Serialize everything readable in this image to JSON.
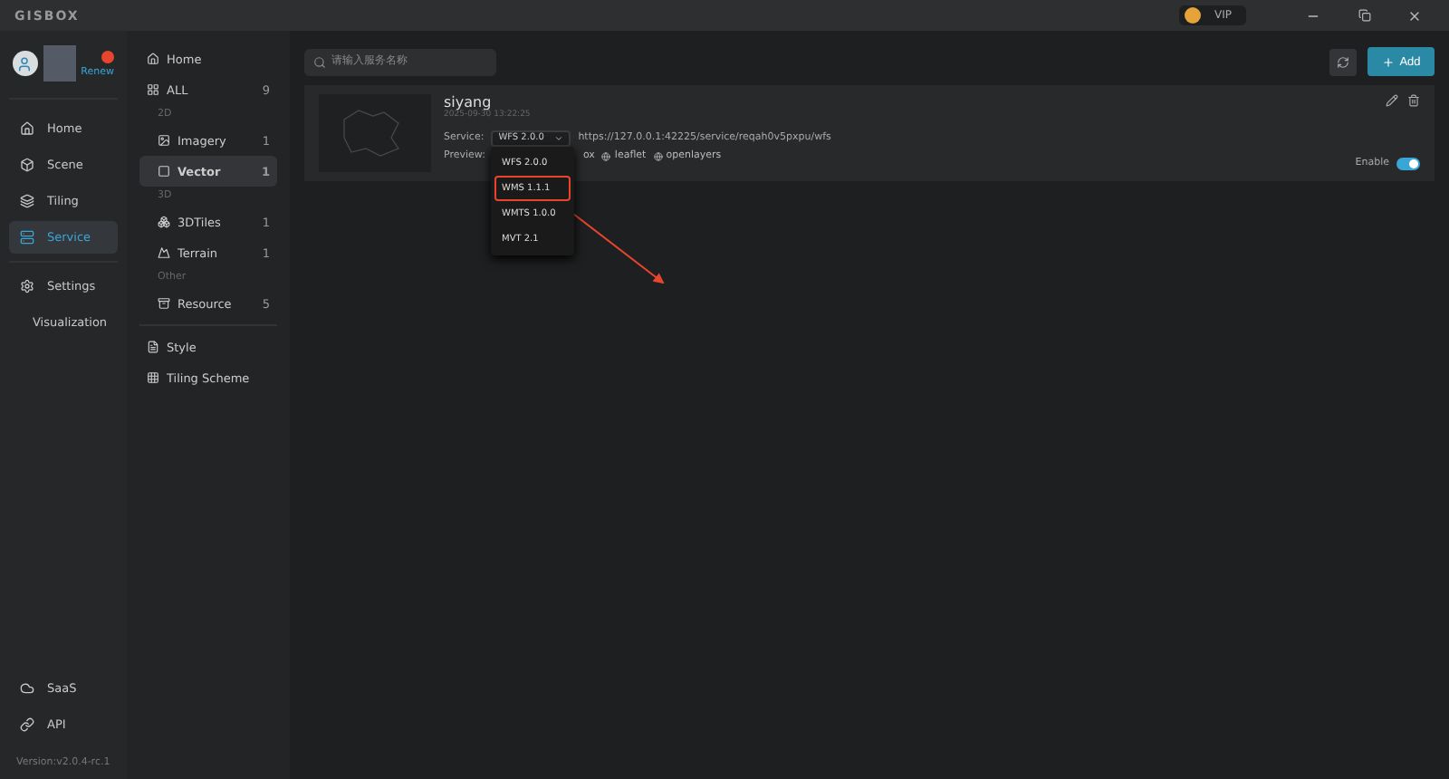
{
  "window": {
    "logo": "GISBOX",
    "vip": "VIP"
  },
  "user": {
    "renew": "Renew"
  },
  "nav": [
    {
      "label": "Home",
      "selected": false
    },
    {
      "label": "Scene",
      "selected": false
    },
    {
      "label": "Tiling",
      "selected": false
    },
    {
      "label": "Service",
      "selected": true
    },
    {
      "label": "Settings",
      "selected": false
    },
    {
      "label": "Visualization",
      "selected": false
    }
  ],
  "nav_bottom": [
    {
      "label": "SaaS"
    },
    {
      "label": "API"
    }
  ],
  "version": "Version:v2.0.4-rc.1",
  "categories": [
    {
      "kind": "item",
      "label": "Home",
      "selected": false
    },
    {
      "kind": "item",
      "label": "ALL",
      "count": "9",
      "selected": false
    },
    {
      "kind": "group",
      "label": "2D"
    },
    {
      "kind": "item",
      "label": "Imagery",
      "count": "1",
      "selected": false
    },
    {
      "kind": "item",
      "label": "Vector",
      "count": "1",
      "selected": true
    },
    {
      "kind": "group",
      "label": "3D"
    },
    {
      "kind": "item",
      "label": "3DTiles",
      "count": "1",
      "selected": false
    },
    {
      "kind": "item",
      "label": "Terrain",
      "count": "1",
      "selected": false
    },
    {
      "kind": "group",
      "label": "Other"
    },
    {
      "kind": "item",
      "label": "Resource",
      "count": "5",
      "selected": false
    }
  ],
  "categories_bottom": [
    {
      "label": "Style"
    },
    {
      "label": "Tiling Scheme"
    }
  ],
  "search": {
    "placeholder": "请输入服务名称"
  },
  "add_button": "Add",
  "services": [
    {
      "name": "siyang",
      "date": "2025-09-30 13:22:25",
      "service_label": "Service:",
      "service_value": "WFS 2.0.0",
      "url": "https://127.0.0.1:42225/service/reqah0v5pxpu/wfs",
      "preview_label": "Preview:",
      "previews": [
        "ox",
        "leaflet",
        "openlayers"
      ],
      "enable_label": "Enable",
      "enabled": true,
      "dropdown": {
        "open": true,
        "options": [
          {
            "label": "WFS 2.0.0",
            "highlighted": false
          },
          {
            "label": "WMS 1.1.1",
            "highlighted": true
          },
          {
            "label": "WMTS 1.0.0",
            "highlighted": false
          },
          {
            "label": "MVT 2.1",
            "highlighted": false
          }
        ]
      }
    }
  ]
}
